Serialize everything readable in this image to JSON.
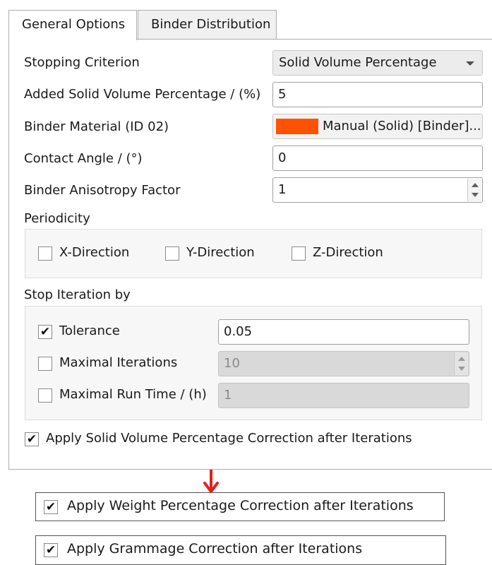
{
  "tabs": [
    {
      "label": "General Options",
      "active": true
    },
    {
      "label": "Binder Distribution",
      "active": false
    }
  ],
  "stopping_criterion": {
    "label": "Stopping Criterion",
    "value": "Solid Volume Percentage"
  },
  "added_solid_volume": {
    "label": "Added Solid Volume Percentage / (%)",
    "value": "5"
  },
  "binder_material": {
    "label": "Binder Material (ID 02)",
    "value": "Manual (Solid) [Binder]...",
    "color": "#ff5200"
  },
  "contact_angle": {
    "label": "Contact Angle / (°)",
    "value": "0"
  },
  "anisotropy": {
    "label": "Binder Anisotropy Factor",
    "value": "1"
  },
  "periodicity": {
    "title": "Periodicity",
    "x": {
      "label": "X-Direction",
      "checked": false
    },
    "y": {
      "label": "Y-Direction",
      "checked": false
    },
    "z": {
      "label": "Z-Direction",
      "checked": false
    }
  },
  "stop_iteration": {
    "title": "Stop Iteration by",
    "tolerance": {
      "label": "Tolerance",
      "checked": true,
      "value": "0.05"
    },
    "max_iterations": {
      "label": "Maximal Iterations",
      "checked": false,
      "value": "10"
    },
    "max_runtime": {
      "label": "Maximal Run Time / (h)",
      "checked": false,
      "value": "1"
    }
  },
  "apply_solid_volume": {
    "label": "Apply Solid Volume Percentage Correction after Iterations",
    "checked": true
  },
  "arrow_color": "#e0221f",
  "alt_options": [
    {
      "label": "Apply Weight Percentage Correction after Iterations",
      "checked": true
    },
    {
      "label": "Apply Grammage Correction after Iterations",
      "checked": true
    }
  ]
}
